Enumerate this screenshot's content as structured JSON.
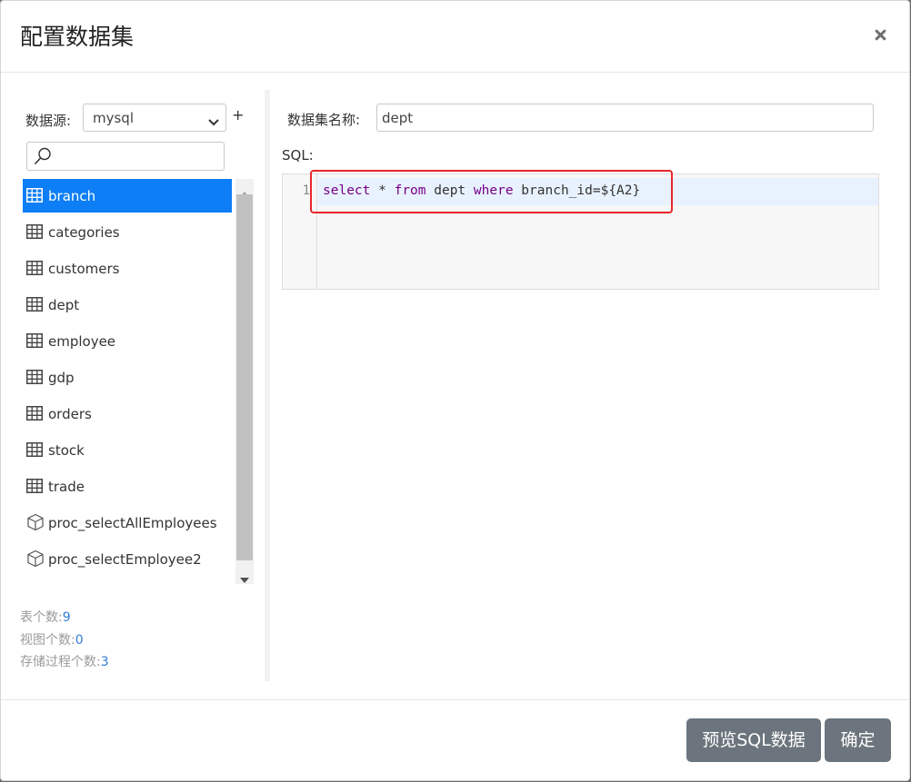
{
  "dialog": {
    "title": "配置数据集",
    "close_icon": "close-icon"
  },
  "datasource": {
    "label": "数据源:",
    "selected": "mysql",
    "add_label": "+"
  },
  "search": {
    "placeholder": ""
  },
  "tree": {
    "items": [
      {
        "label": "branch",
        "icon": "table-icon",
        "active": true
      },
      {
        "label": "categories",
        "icon": "table-icon",
        "active": false
      },
      {
        "label": "customers",
        "icon": "table-icon",
        "active": false
      },
      {
        "label": "dept",
        "icon": "table-icon",
        "active": false
      },
      {
        "label": "employee",
        "icon": "table-icon",
        "active": false
      },
      {
        "label": "gdp",
        "icon": "table-icon",
        "active": false
      },
      {
        "label": "orders",
        "icon": "table-icon",
        "active": false
      },
      {
        "label": "stock",
        "icon": "table-icon",
        "active": false
      },
      {
        "label": "trade",
        "icon": "table-icon",
        "active": false
      },
      {
        "label": "proc_selectAllEmployees",
        "icon": "cube-icon",
        "active": false
      },
      {
        "label": "proc_selectEmployee2",
        "icon": "cube-icon",
        "active": false
      }
    ]
  },
  "stats": {
    "tables_label": "表个数:",
    "tables_count": "9",
    "views_label": "视图个数:",
    "views_count": "0",
    "procs_label": "存储过程个数:",
    "procs_count": "3"
  },
  "form": {
    "name_label": "数据集名称:",
    "name_value": "dept",
    "sql_label": "SQL:"
  },
  "editor": {
    "line_number": "1",
    "tokens": {
      "kw_select": "select",
      "t_star": " * ",
      "kw_from": "from",
      "t_table": " dept ",
      "kw_where": "where",
      "t_cond": " branch_id=${A2}"
    }
  },
  "footer": {
    "preview_label": "预览SQL数据",
    "ok_label": "确定"
  },
  "colors": {
    "active_item": "#0d7ef5",
    "keyword": "#770088",
    "count_link": "#2f7dd6",
    "highlight_box": "#e8262b",
    "button_bg": "#6c757d"
  }
}
